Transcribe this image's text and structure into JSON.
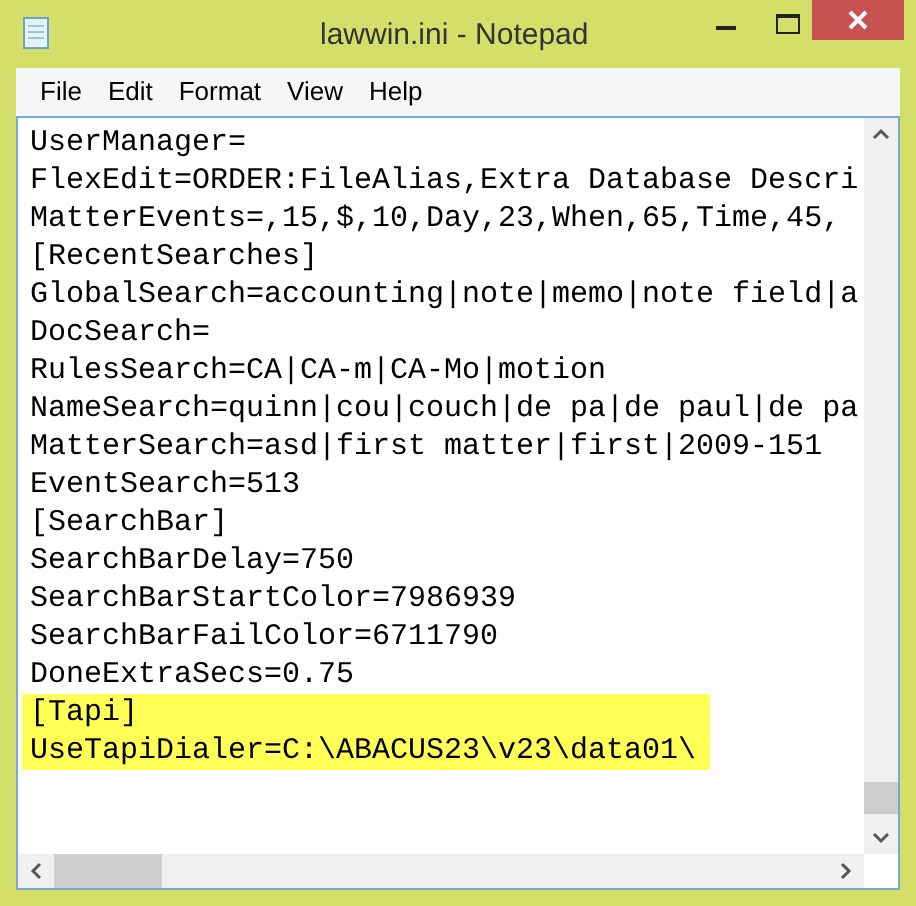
{
  "window": {
    "title": "lawwin.ini - Notepad"
  },
  "menu": [
    "File",
    "Edit",
    "Format",
    "View",
    "Help"
  ],
  "lines": [
    {
      "text": "UserManager=",
      "selected": false
    },
    {
      "text": "FlexEdit=ORDER:FileAlias,Extra Database Descri",
      "selected": false
    },
    {
      "text": "MatterEvents=,15,$,10,Day,23,When,65,Time,45,",
      "selected": false
    },
    {
      "text": "[RecentSearches]",
      "selected": false
    },
    {
      "text": "GlobalSearch=accounting|note|memo|note field|a",
      "selected": false
    },
    {
      "text": "DocSearch=",
      "selected": false
    },
    {
      "text": "RulesSearch=CA|CA-m|CA-Mo|motion",
      "selected": false
    },
    {
      "text": "NameSearch=quinn|cou|couch|de pa|de paul|de pa",
      "selected": false
    },
    {
      "text": "MatterSearch=asd|first matter|first|2009-151",
      "selected": false
    },
    {
      "text": "EventSearch=513",
      "selected": false
    },
    {
      "text": "[SearchBar]",
      "selected": false
    },
    {
      "text": "SearchBarDelay=750",
      "selected": false
    },
    {
      "text": "SearchBarStartColor=7986939",
      "selected": false
    },
    {
      "text": "SearchBarFailColor=6711790",
      "selected": false
    },
    {
      "text": "DoneExtraSecs=0.75",
      "selected": false
    },
    {
      "text": "[Tapi]",
      "selected": true
    },
    {
      "text": "UseTapiDialer=C:\\ABACUS23\\v23\\data01\\",
      "selected": true
    }
  ]
}
